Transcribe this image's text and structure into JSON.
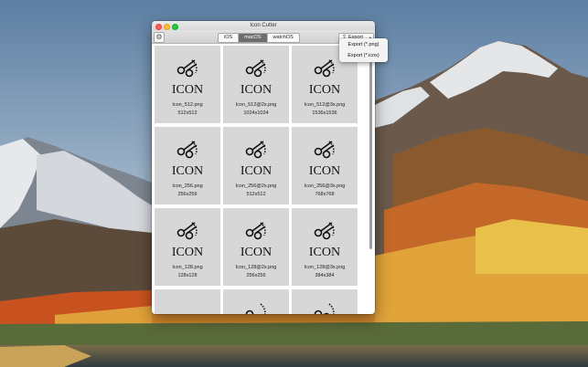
{
  "window": {
    "title": "Icon Cutter"
  },
  "toolbar": {
    "settings_icon": "gear-icon",
    "segments": [
      {
        "label": "iOS",
        "active": false
      },
      {
        "label": "macOS",
        "active": true
      },
      {
        "label": "watchOS",
        "active": false
      }
    ],
    "export_label": "Export",
    "export_icon": "share-icon"
  },
  "export_menu": {
    "items": [
      {
        "label": "Export (*.png)"
      },
      {
        "label": "Export (*.icns)"
      }
    ]
  },
  "icon_art": {
    "text": "ICON",
    "symbol": "scissors-icon"
  },
  "icons": [
    {
      "name": "Icon_512.png",
      "size": "512x512"
    },
    {
      "name": "Icon_512@2x.png",
      "size": "1024x1024"
    },
    {
      "name": "Icon_512@3x.png",
      "size": "1536x1536"
    },
    {
      "name": "Icon_256.png",
      "size": "256x256"
    },
    {
      "name": "Icon_256@2x.png",
      "size": "512x512"
    },
    {
      "name": "Icon_256@3x.png",
      "size": "768x768"
    },
    {
      "name": "Icon_128.png",
      "size": "128x128"
    },
    {
      "name": "Icon_128@2x.png",
      "size": "256x256"
    },
    {
      "name": "Icon_128@3x.png",
      "size": "384x384"
    }
  ],
  "colors": {
    "active_segment": "#6d6d6d",
    "cell_background": "#d7d7d7"
  }
}
